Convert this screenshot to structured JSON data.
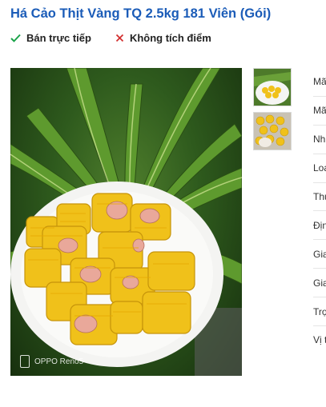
{
  "product": {
    "title": "Há Cảo Thịt Vàng TQ 2.5kg 181 Viên (Gói)"
  },
  "badges": [
    {
      "label": "Bán trực tiếp",
      "icon": "check-icon",
      "color": "#1aa34a"
    },
    {
      "label": "Không tích điểm",
      "icon": "close-icon",
      "color": "#d32f2f"
    }
  ],
  "photo": {
    "watermark": "OPPO Reno5"
  },
  "thumbnails": [
    {
      "alt": "dumplings-plate-thumb"
    },
    {
      "alt": "dumplings-closeup-thumb"
    }
  ],
  "attributes": [
    {
      "label": "Mã"
    },
    {
      "label": "Mã"
    },
    {
      "label": "Nh"
    },
    {
      "label": "Loạ"
    },
    {
      "label": "Thu"
    },
    {
      "label": "Địn"
    },
    {
      "label": "Gia"
    },
    {
      "label": "Gia"
    },
    {
      "label": "Trọ"
    },
    {
      "label": "Vị t"
    }
  ]
}
